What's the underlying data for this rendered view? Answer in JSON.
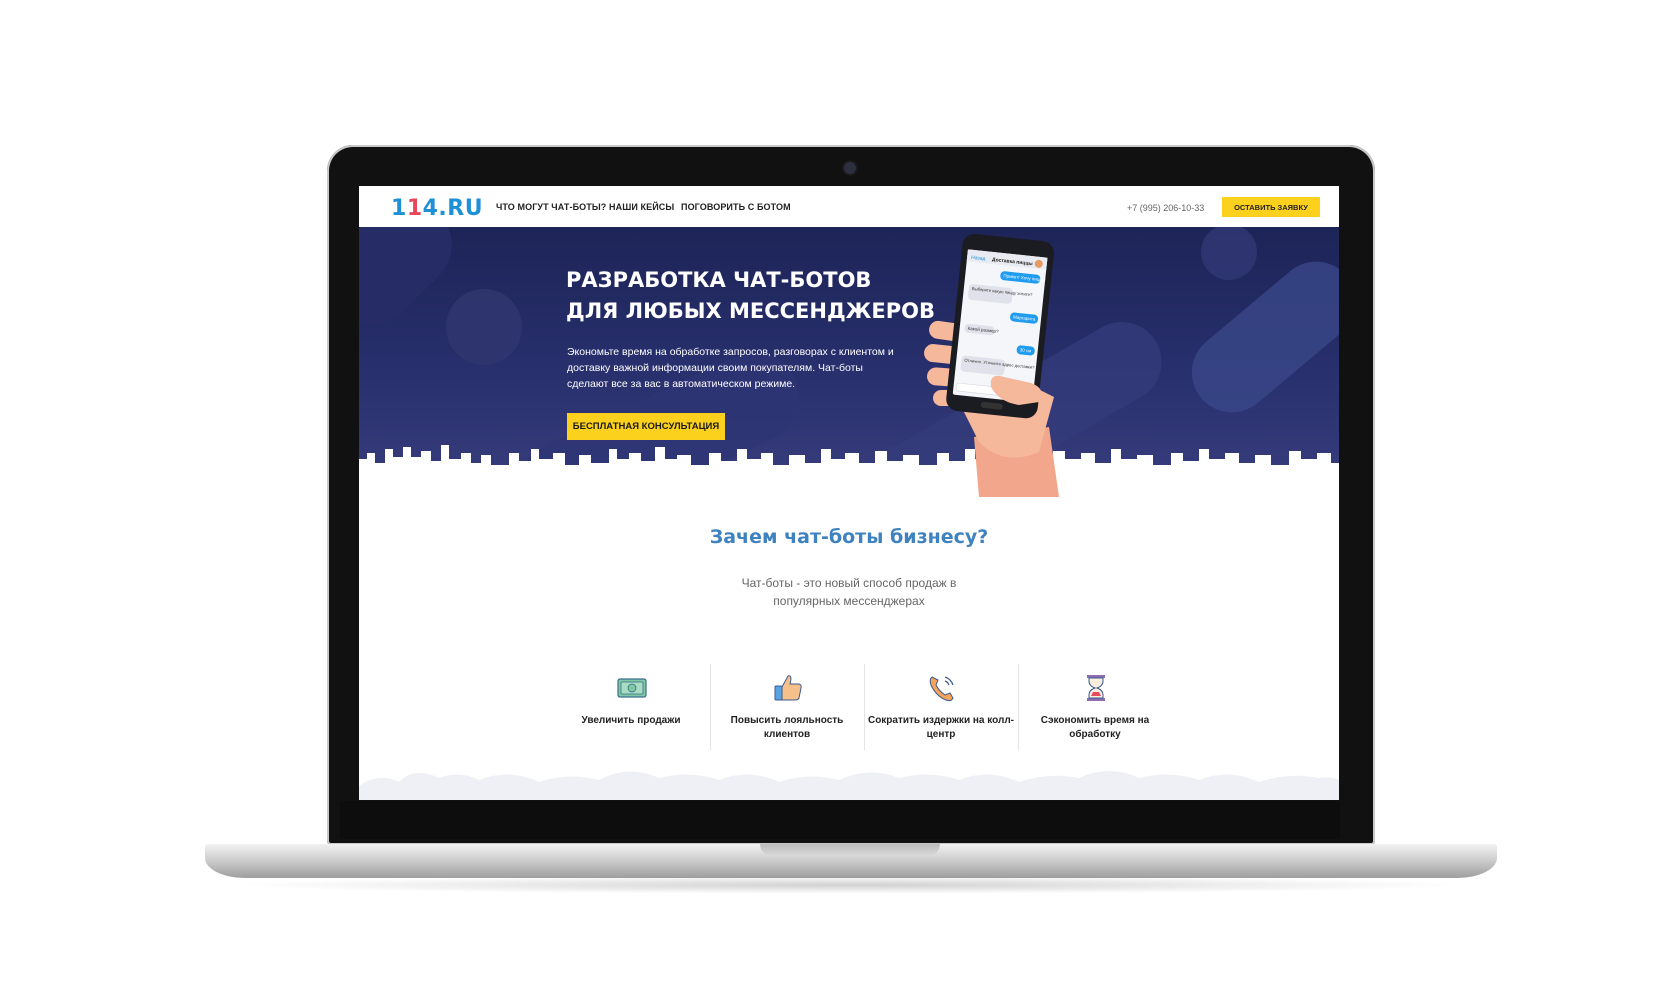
{
  "header": {
    "logo": {
      "left": "1",
      "mid": "1",
      "right": "4.RU"
    },
    "nav": [
      "ЧТО МОГУТ ЧАТ-БОТЫ?",
      "НАШИ КЕЙСЫ",
      "ПОГОВОРИТЬ С БОТОМ"
    ],
    "phone": "+7 (995) 206-10-33",
    "cta_label": "ОСТАВИТЬ ЗАЯВКУ"
  },
  "hero": {
    "title_line1": "РАЗРАБОТКА ЧАТ-БОТОВ",
    "title_line2": "ДЛЯ ЛЮБЫХ МЕССЕНДЖЕРОВ",
    "description": "Экономьте время на обработке запросов, разговорах с клиентом и доставку важной информации своим покупателям. Чат-боты сделают все за вас в автоматическом режиме.",
    "button_label": "БЕСПЛАТНАЯ КОНСУЛЬТАЦИЯ"
  },
  "phone_chat": {
    "header_back": "Назад",
    "header_title": "Доставка пиццы",
    "messages": [
      {
        "from": "user",
        "text": "Привет! Хочу пиццу!"
      },
      {
        "from": "bot",
        "text": "Выберите какую пиццу хотите?"
      },
      {
        "from": "user",
        "text": "Маргарита"
      },
      {
        "from": "bot",
        "text": "Какой размер?"
      },
      {
        "from": "user",
        "text": "30 см"
      },
      {
        "from": "bot",
        "text": "Отлично. Уточните адрес доставки?"
      }
    ]
  },
  "why": {
    "title": "Зачем чат-боты бизнесу?",
    "subtitle": "Чат-боты - это новый способ продаж в популярных мессенджерах"
  },
  "features": [
    {
      "label": "Увеличить продажи",
      "icon": "money-icon"
    },
    {
      "label": "Повысить лояльность клиентов",
      "icon": "thumbs-up-icon"
    },
    {
      "label": "Сократить издержки на колл-центр",
      "icon": "phone-call-icon"
    },
    {
      "label": "Сэкономить время на обработку",
      "icon": "hourglass-icon"
    }
  ],
  "colors": {
    "accent_yellow": "#fcd11e",
    "hero_bg": "#1d2457",
    "title_blue": "#3e82bf",
    "logo_blue": "#1f8fd6"
  }
}
